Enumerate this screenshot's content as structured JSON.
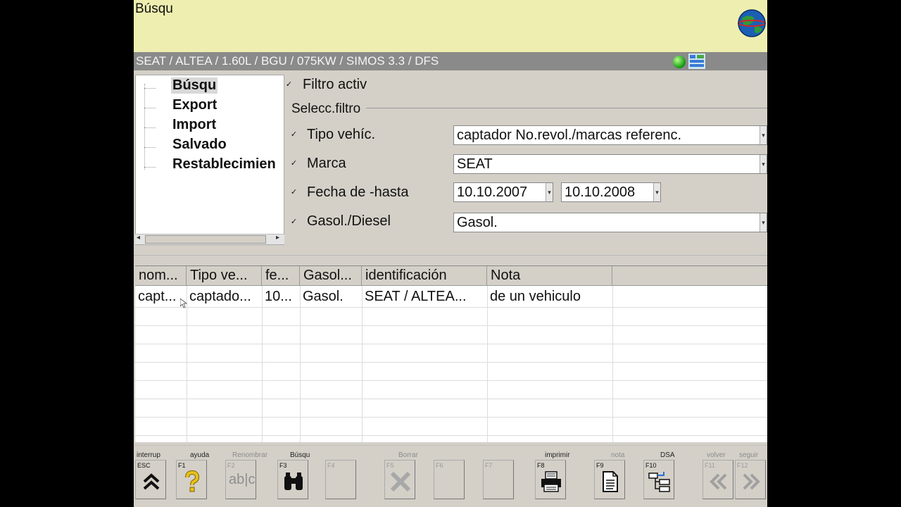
{
  "header": {
    "title": "Búsqu"
  },
  "vehicle": {
    "text": "SEAT / ALTEA / 1.60L / BGU / 075KW / SIMOS 3.3 / DFS"
  },
  "tree": {
    "items": [
      "Búsqu",
      "Export",
      "Import",
      "Salvado",
      "Restablecimien"
    ]
  },
  "filters": {
    "active_label": "Filtro activ",
    "group_label": "Selecc.filtro",
    "tipo_label": "Tipo vehíc.",
    "tipo_value": "captador No.revol./marcas referenc.",
    "marca_label": "Marca",
    "marca_value": "SEAT",
    "fecha_label": "Fecha de -hasta",
    "fecha_from": "10.10.2007",
    "fecha_to": "10.10.2008",
    "fuel_label": "Gasol./Diesel",
    "fuel_value": "Gasol."
  },
  "table": {
    "headers": [
      "nom...",
      "Tipo ve...",
      "fe...",
      "Gasol...",
      "identificación",
      "Nota"
    ],
    "rows": [
      [
        "capt...",
        "captado...",
        "10...",
        "Gasol.",
        "SEAT / ALTEA...",
        "de un vehiculo"
      ]
    ]
  },
  "fkeys": {
    "interrup": {
      "caption": "interrup",
      "code": "ESC"
    },
    "ayuda": {
      "caption": "ayuda",
      "code": "F1"
    },
    "renombrar": {
      "caption": "Renombrar",
      "code": "F2"
    },
    "busqu": {
      "caption": "Búsqu",
      "code": "F3"
    },
    "f4": {
      "code": "F4"
    },
    "borrar": {
      "caption": "Borrar",
      "code": "F5"
    },
    "f6": {
      "code": "F6"
    },
    "f7": {
      "code": "F7"
    },
    "imprimir": {
      "caption": "imprimir",
      "code": "F8"
    },
    "nota": {
      "caption": "nota",
      "code": "F9"
    },
    "dsa": {
      "caption": "DSA",
      "code": "F10"
    },
    "volver": {
      "caption": "volver",
      "code": "F11"
    },
    "seguir": {
      "caption": "seguir",
      "code": "F12"
    },
    "rename_icon_text": "ab|c"
  },
  "icons": {
    "globe": "globe-icon",
    "status": "status-led-icon",
    "help": "question-mark-icon",
    "search": "binoculars-icon",
    "delete": "x-icon",
    "print": "printer-icon",
    "note": "document-icon",
    "dsa": "tree-structure-icon",
    "back": "double-chevron-left-icon",
    "forward": "double-chevron-right-icon",
    "exit": "double-chevron-up-icon"
  },
  "colors": {
    "header_bg": "#eeeeb0",
    "vehicle_bar_bg": "#8a8a8a",
    "help_icon": "#e6c21a",
    "status_led": "#21a51a"
  }
}
